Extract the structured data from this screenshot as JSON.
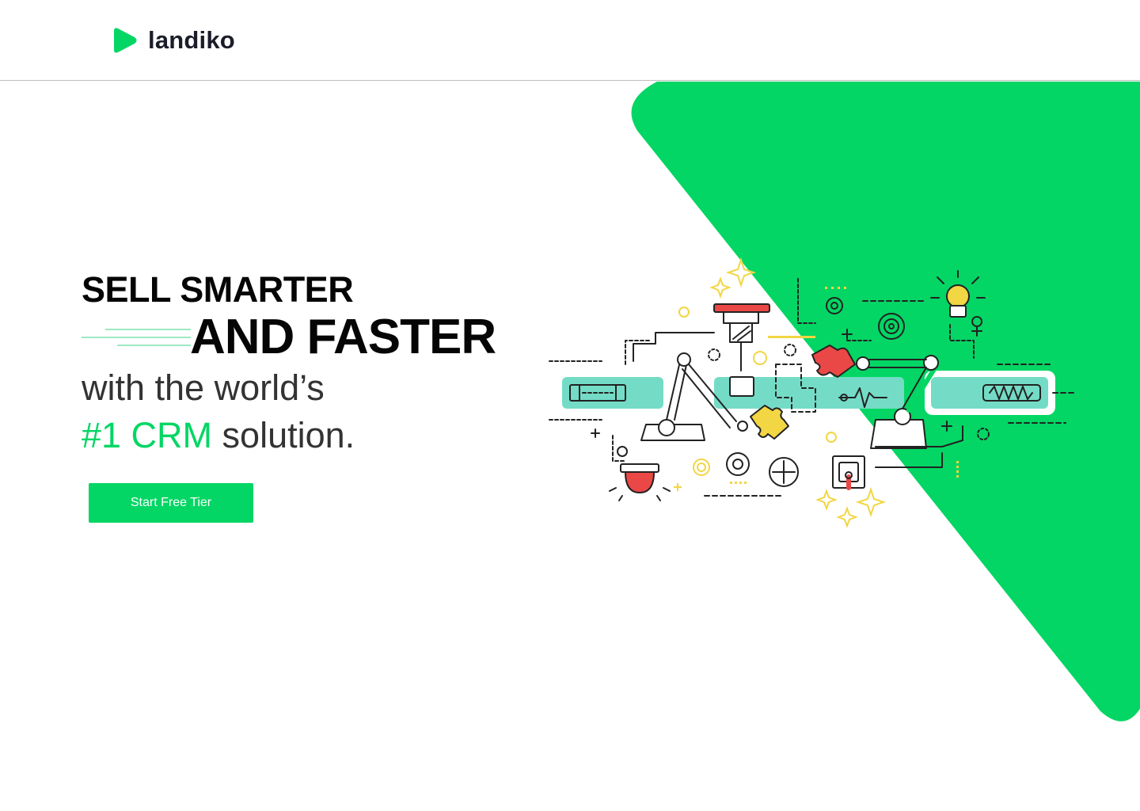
{
  "header": {
    "logo_text": "landiko",
    "logo_icon": "play-triangle-icon"
  },
  "hero": {
    "headline_line1": "SELL SMARTER",
    "headline_line2": "AND FASTER",
    "sub_line1": "with the world’s",
    "sub_accent": "#1 CRM",
    "sub_line2_rest": " solution.",
    "cta_label": "Start Free Tier"
  },
  "illustration": {
    "name": "robotic-assembly-line-illustration"
  },
  "colors": {
    "accent": "#03d664",
    "text_dark": "#050505",
    "text_body": "#333333",
    "conveyor": "#74dcc6",
    "puzzle_red": "#ea4846",
    "puzzle_yellow": "#f2d643"
  }
}
